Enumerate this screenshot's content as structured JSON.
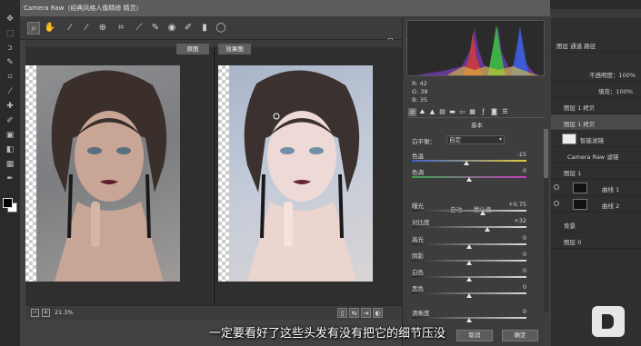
{
  "window": {
    "title": "Camera Raw（经典风格人像精修 精灵）"
  },
  "toolbar": {
    "tools": [
      "zoom-icon",
      "hand-icon",
      "eyedropper-icon",
      "color-sampler-icon",
      "target-adjust-icon",
      "crop-icon",
      "straighten-icon",
      "spot-removal-icon",
      "red-eye-icon",
      "adjustment-brush-icon",
      "graduated-filter-icon",
      "radial-filter-icon"
    ]
  },
  "views": {
    "before_label": "原图",
    "after_label": "效果图"
  },
  "footer": {
    "zoom": "21.3%"
  },
  "histogram": {
    "r": "R:    42",
    "g": "G:    38",
    "b": "B:    35"
  },
  "panel": {
    "title": "基本",
    "white_balance_label": "白平衡：",
    "white_balance_value": "自定",
    "auto_label": "自动",
    "default_label": "默认值",
    "sliders": [
      {
        "label": "色温",
        "value": "-15",
        "pos": 0.48
      },
      {
        "label": "色调",
        "value": "0",
        "pos": 0.5
      },
      {
        "label": "曝光",
        "value": "+0.75",
        "pos": 0.62
      },
      {
        "label": "对比度",
        "value": "+32",
        "pos": 0.66
      },
      {
        "label": "高光",
        "value": "0",
        "pos": 0.5
      },
      {
        "label": "阴影",
        "value": "0",
        "pos": 0.5
      },
      {
        "label": "白色",
        "value": "0",
        "pos": 0.5
      },
      {
        "label": "黑色",
        "value": "0",
        "pos": 0.5
      },
      {
        "label": "清晰度",
        "value": "0",
        "pos": 0.5
      }
    ]
  },
  "buttons": {
    "cancel": "取消",
    "ok": "确定"
  },
  "subtitle": "一定要看好了这些头发有没有把它的细节压没",
  "ps_layers": {
    "tabs": "图层  通道  路径",
    "opacity": "不透明度：100%",
    "fill": "填充：100%",
    "rows": [
      {
        "name": "图层 1 拷贝",
        "thumb": "dark"
      },
      {
        "name": "图层 1 拷贝",
        "thumb": "dark",
        "selected": true
      },
      {
        "name": "智能滤镜",
        "thumb": "white"
      },
      {
        "name": "Camera Raw 滤镜",
        "thumb": ""
      },
      {
        "name": "图层 1",
        "thumb": ""
      },
      {
        "name": "曲线 1",
        "thumb": "dark"
      },
      {
        "name": "曲线 2",
        "thumb": "dark"
      },
      {
        "name": "背景",
        "thumb": ""
      },
      {
        "name": "图层 0",
        "thumb": ""
      }
    ]
  }
}
